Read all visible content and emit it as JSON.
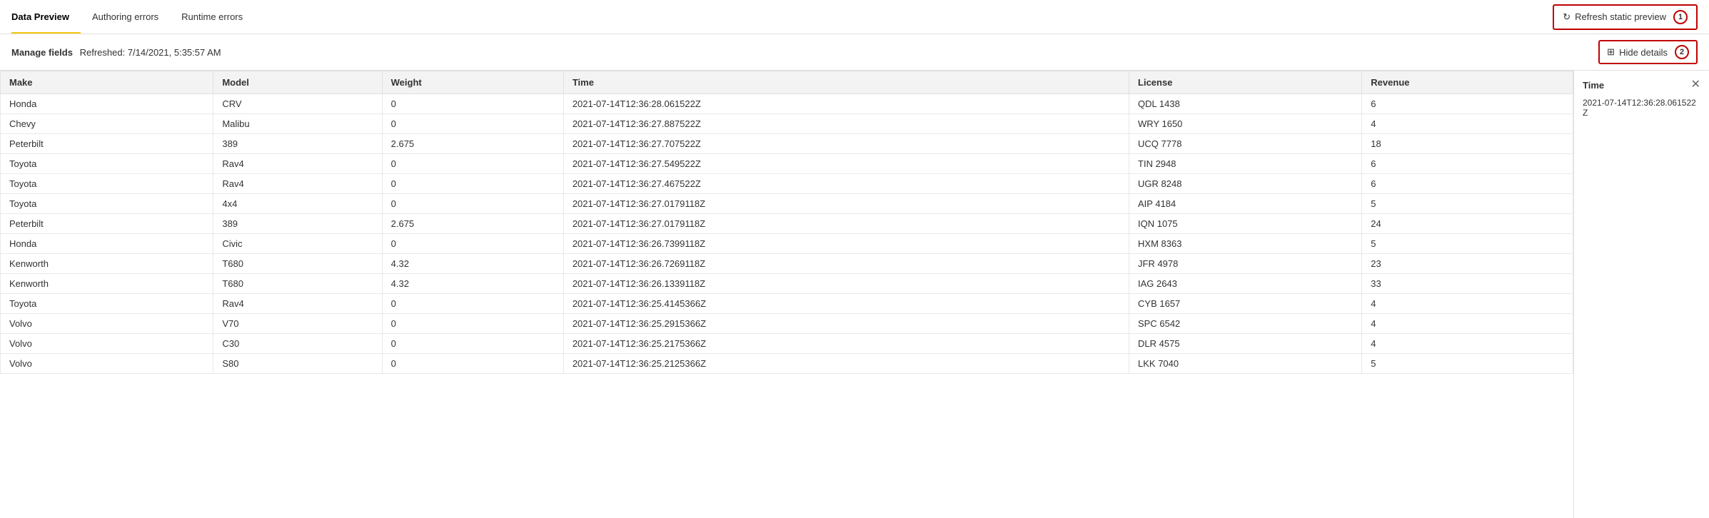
{
  "tabs": [
    {
      "id": "data-preview",
      "label": "Data Preview",
      "active": true
    },
    {
      "id": "authoring-errors",
      "label": "Authoring errors",
      "active": false
    },
    {
      "id": "runtime-errors",
      "label": "Runtime errors",
      "active": false
    }
  ],
  "toolbar": {
    "refresh_label": "Refresh static preview",
    "refresh_icon": "↻",
    "badge1": "1",
    "hide_details_label": "Hide details",
    "hide_details_icon": "⊞",
    "badge2": "2"
  },
  "manage_fields": {
    "label": "Manage fields",
    "refreshed": "Refreshed: 7/14/2021, 5:35:57 AM"
  },
  "table": {
    "columns": [
      "Make",
      "Model",
      "Weight",
      "Time",
      "License",
      "Revenue"
    ],
    "rows": [
      [
        "Honda",
        "CRV",
        "0",
        "2021-07-14T12:36:28.061522Z",
        "QDL 1438",
        "6"
      ],
      [
        "Chevy",
        "Malibu",
        "0",
        "2021-07-14T12:36:27.887522Z",
        "WRY 1650",
        "4"
      ],
      [
        "Peterbilt",
        "389",
        "2.675",
        "2021-07-14T12:36:27.707522Z",
        "UCQ 7778",
        "18"
      ],
      [
        "Toyota",
        "Rav4",
        "0",
        "2021-07-14T12:36:27.549522Z",
        "TIN 2948",
        "6"
      ],
      [
        "Toyota",
        "Rav4",
        "0",
        "2021-07-14T12:36:27.467522Z",
        "UGR 8248",
        "6"
      ],
      [
        "Toyota",
        "4x4",
        "0",
        "2021-07-14T12:36:27.0179118Z",
        "AIP 4184",
        "5"
      ],
      [
        "Peterbilt",
        "389",
        "2.675",
        "2021-07-14T12:36:27.0179118Z",
        "IQN 1075",
        "24"
      ],
      [
        "Honda",
        "Civic",
        "0",
        "2021-07-14T12:36:26.7399118Z",
        "HXM 8363",
        "5"
      ],
      [
        "Kenworth",
        "T680",
        "4.32",
        "2021-07-14T12:36:26.7269118Z",
        "JFR 4978",
        "23"
      ],
      [
        "Kenworth",
        "T680",
        "4.32",
        "2021-07-14T12:36:26.1339118Z",
        "IAG 2643",
        "33"
      ],
      [
        "Toyota",
        "Rav4",
        "0",
        "2021-07-14T12:36:25.4145366Z",
        "CYB 1657",
        "4"
      ],
      [
        "Volvo",
        "V70",
        "0",
        "2021-07-14T12:36:25.2915366Z",
        "SPC 6542",
        "4"
      ],
      [
        "Volvo",
        "C30",
        "0",
        "2021-07-14T12:36:25.2175366Z",
        "DLR 4575",
        "4"
      ],
      [
        "Volvo",
        "S80",
        "0",
        "2021-07-14T12:36:25.2125366Z",
        "LKK 7040",
        "5"
      ]
    ]
  },
  "detail_panel": {
    "title": "Time",
    "value": "2021-07-14T12:36:28.061522Z"
  }
}
